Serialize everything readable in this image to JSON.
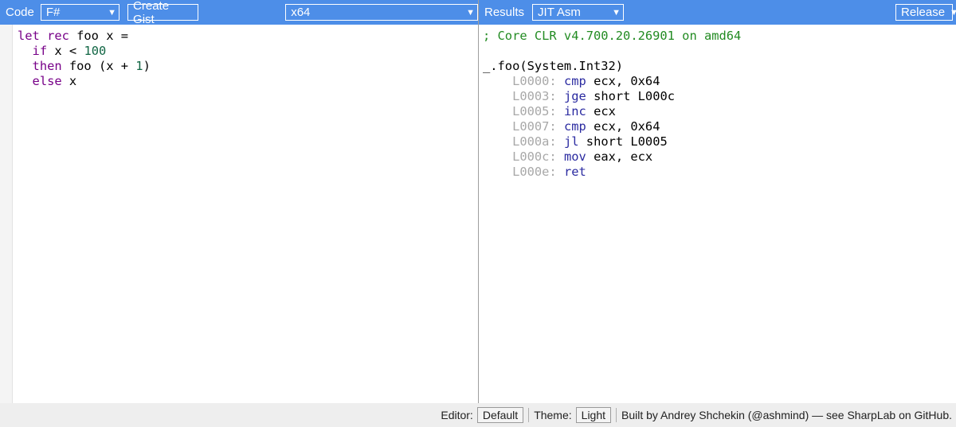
{
  "code_toolbar": {
    "label": "Code",
    "language_value": "F#",
    "create_gist_label": "Create Gist",
    "platform_value": "x64"
  },
  "results_toolbar": {
    "label": "Results",
    "target_value": "JIT Asm",
    "mode_value": "Release"
  },
  "source_code": {
    "lines": [
      [
        {
          "t": "let rec",
          "c": "kw"
        },
        {
          "t": " foo x =",
          "c": ""
        }
      ],
      [
        {
          "t": "  ",
          "c": ""
        },
        {
          "t": "if",
          "c": "kw"
        },
        {
          "t": " x < ",
          "c": ""
        },
        {
          "t": "100",
          "c": "num"
        }
      ],
      [
        {
          "t": "  ",
          "c": ""
        },
        {
          "t": "then",
          "c": "kw"
        },
        {
          "t": " foo (x + ",
          "c": ""
        },
        {
          "t": "1",
          "c": "num"
        },
        {
          "t": ")",
          "c": ""
        }
      ],
      [
        {
          "t": "  ",
          "c": ""
        },
        {
          "t": "else",
          "c": "kw"
        },
        {
          "t": " x",
          "c": ""
        }
      ]
    ]
  },
  "output": {
    "header_comment": "; Core CLR v4.700.20.26901 on amd64",
    "method": "_.foo(System.Int32)",
    "instructions": [
      {
        "addr": "L0000:",
        "op": "cmp",
        "args": "ecx, 0x64"
      },
      {
        "addr": "L0003:",
        "op": "jge",
        "args": "short L000c"
      },
      {
        "addr": "L0005:",
        "op": "inc",
        "args": "ecx"
      },
      {
        "addr": "L0007:",
        "op": "cmp",
        "args": "ecx, 0x64"
      },
      {
        "addr": "L000a:",
        "op": "jl",
        "args": "short L0005"
      },
      {
        "addr": "L000c:",
        "op": "mov",
        "args": "eax, ecx"
      },
      {
        "addr": "L000e:",
        "op": "ret",
        "args": ""
      }
    ]
  },
  "footer": {
    "editor_label": "Editor:",
    "editor_value": "Default",
    "theme_label": "Theme:",
    "theme_value": "Light",
    "credit_text": "Built by Andrey Shchekin (@ashmind) — see SharpLab on GitHub."
  },
  "colors": {
    "toolbar_bg": "#4d8ee8",
    "keyword": "#770088",
    "number": "#116644",
    "comment": "#228b22",
    "address": "#a8a8a8",
    "opcode": "#2a2aa0"
  },
  "icons": {
    "dropdown": "dropdown-arrow-icon"
  }
}
